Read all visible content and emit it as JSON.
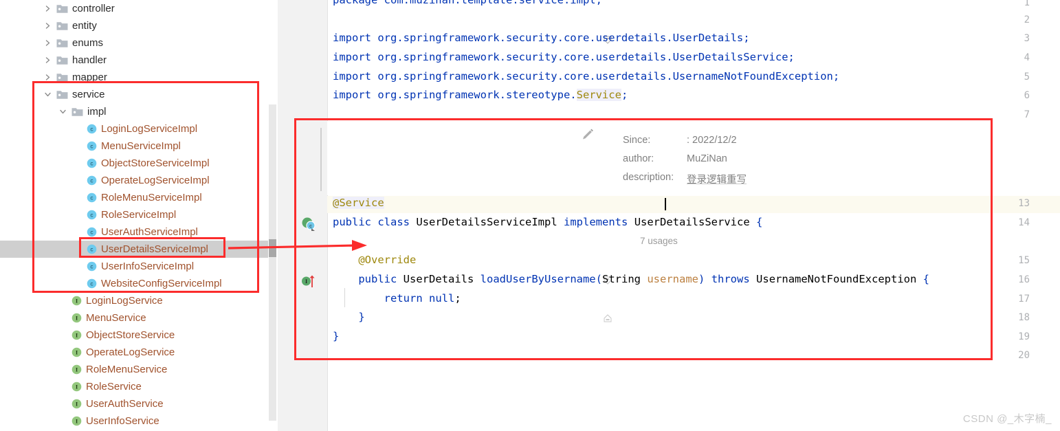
{
  "tree": {
    "rows": [
      {
        "label": "controller",
        "kind": "folder",
        "depth": 1,
        "expanded": false,
        "chevron": "chevron-right"
      },
      {
        "label": "entity",
        "kind": "folder",
        "depth": 1,
        "expanded": false,
        "chevron": "chevron-right"
      },
      {
        "label": "enums",
        "kind": "folder",
        "depth": 1,
        "expanded": false,
        "chevron": "chevron-right"
      },
      {
        "label": "handler",
        "kind": "folder",
        "depth": 1,
        "expanded": false,
        "chevron": "chevron-right"
      },
      {
        "label": "mapper",
        "kind": "folder",
        "depth": 1,
        "expanded": false,
        "chevron": "chevron-right"
      },
      {
        "label": "service",
        "kind": "folder",
        "depth": 1,
        "expanded": true,
        "chevron": "chevron-down"
      },
      {
        "label": "impl",
        "kind": "folder",
        "depth": 2,
        "expanded": true,
        "chevron": "chevron-down"
      },
      {
        "label": "LoginLogServiceImpl",
        "kind": "class",
        "depth": 3,
        "expanded": false,
        "chevron": "none"
      },
      {
        "label": "MenuServiceImpl",
        "kind": "class",
        "depth": 3,
        "expanded": false,
        "chevron": "none"
      },
      {
        "label": "ObjectStoreServiceImpl",
        "kind": "class",
        "depth": 3,
        "expanded": false,
        "chevron": "none"
      },
      {
        "label": "OperateLogServiceImpl",
        "kind": "class",
        "depth": 3,
        "expanded": false,
        "chevron": "none"
      },
      {
        "label": "RoleMenuServiceImpl",
        "kind": "class",
        "depth": 3,
        "expanded": false,
        "chevron": "none"
      },
      {
        "label": "RoleServiceImpl",
        "kind": "class",
        "depth": 3,
        "expanded": false,
        "chevron": "none"
      },
      {
        "label": "UserAuthServiceImpl",
        "kind": "class",
        "depth": 3,
        "expanded": false,
        "chevron": "none"
      },
      {
        "label": "UserDetailsServiceImpl",
        "kind": "class",
        "depth": 3,
        "expanded": false,
        "chevron": "none",
        "selected": true
      },
      {
        "label": "UserInfoServiceImpl",
        "kind": "class",
        "depth": 3,
        "expanded": false,
        "chevron": "none"
      },
      {
        "label": "WebsiteConfigServiceImpl",
        "kind": "class",
        "depth": 3,
        "expanded": false,
        "chevron": "none"
      },
      {
        "label": "LoginLogService",
        "kind": "interface",
        "depth": 2,
        "expanded": false,
        "chevron": "none"
      },
      {
        "label": "MenuService",
        "kind": "interface",
        "depth": 2,
        "expanded": false,
        "chevron": "none"
      },
      {
        "label": "ObjectStoreService",
        "kind": "interface",
        "depth": 2,
        "expanded": false,
        "chevron": "none"
      },
      {
        "label": "OperateLogService",
        "kind": "interface",
        "depth": 2,
        "expanded": false,
        "chevron": "none"
      },
      {
        "label": "RoleMenuService",
        "kind": "interface",
        "depth": 2,
        "expanded": false,
        "chevron": "none"
      },
      {
        "label": "RoleService",
        "kind": "interface",
        "depth": 2,
        "expanded": false,
        "chevron": "none"
      },
      {
        "label": "UserAuthService",
        "kind": "interface",
        "depth": 2,
        "expanded": false,
        "chevron": "none"
      },
      {
        "label": "UserInfoService",
        "kind": "interface",
        "depth": 2,
        "expanded": false,
        "chevron": "none"
      }
    ]
  },
  "editor": {
    "line_numbers": [
      "1",
      "2",
      "3",
      "4",
      "5",
      "6",
      "7",
      "13",
      "14",
      "15",
      "16",
      "17",
      "18",
      "19",
      "20"
    ],
    "current_line": "13",
    "usages_inlay": "7 usages",
    "javadoc": {
      "rows": [
        {
          "key": "Since:",
          "value": ": 2022/12/2"
        },
        {
          "key": "author:",
          "value": "MuZiNan"
        },
        {
          "key": "description:",
          "value": "登录逻辑重写"
        }
      ]
    },
    "code": {
      "package_stmt": "package com.muzinan.template.service.impl;",
      "import_1": "import org.springframework.security.core.userdetails.UserDetails;",
      "import_2": "import org.springframework.security.core.userdetails.UserDetailsService;",
      "import_3": "import org.springframework.security.core.userdetails.UsernameNotFoundException;",
      "import_4_pre": "import org.springframework.stereotype.",
      "import_4_cls": "Service",
      "import_4_end": ";",
      "annotation_service": "@Service",
      "class_kw_public": "public",
      "class_kw_class": "class",
      "class_name": "UserDetailsServiceImpl",
      "class_kw_implements": "implements",
      "class_interface": "UserDetailsService",
      "class_open_brace": "{",
      "annotation_override": "@Override",
      "method_kw_public": "public",
      "method_return_type": "UserDetails",
      "method_name": "loadUserByUsername",
      "method_paren_open": "(",
      "method_param_type": "String",
      "method_param_name": "username",
      "method_paren_close": ")",
      "method_kw_throws": "throws",
      "method_exception": "UsernameNotFoundException",
      "method_open_brace": "{",
      "body_kw_return": "return",
      "body_null": "null",
      "body_semicolon": ";",
      "method_close_brace": "}",
      "class_close_brace": "}"
    }
  },
  "watermark": {
    "text": "CSDN @_木字楠_"
  },
  "colors": {
    "keyword": "#0033b3",
    "annotation": "#9e880d",
    "parameter": "#bc8040",
    "class_label": "#a0522d",
    "selection": "#cccccc",
    "annotation_red": "#fb2c2c",
    "current_line": "#fcfaef",
    "gutter_bg": "#f2f2f2"
  }
}
